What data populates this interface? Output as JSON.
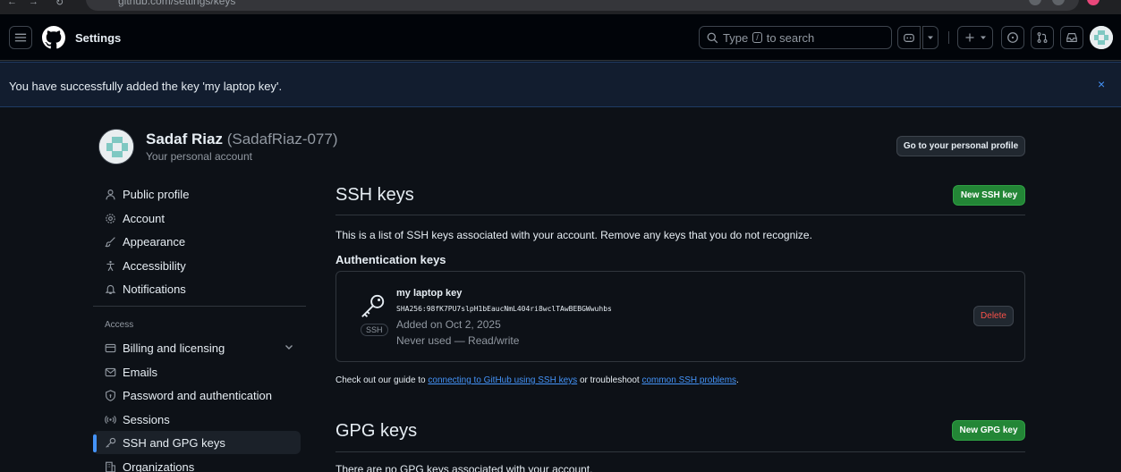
{
  "browser": {
    "url": "github.com/settings/keys"
  },
  "header": {
    "title": "Settings",
    "search_prefix": "Type",
    "search_key": "/",
    "search_suffix": "to search"
  },
  "flash": {
    "message": "You have successfully added the key 'my laptop key'.",
    "close": "×"
  },
  "user": {
    "name": "Sadaf Riaz",
    "login": "(SadafRiaz-077)",
    "subtitle": "Your personal account",
    "profile_button": "Go to your personal profile"
  },
  "sidebar": {
    "items": [
      {
        "label": "Public profile",
        "icon": "person-icon"
      },
      {
        "label": "Account",
        "icon": "gear-icon"
      },
      {
        "label": "Appearance",
        "icon": "paintbrush-icon"
      },
      {
        "label": "Accessibility",
        "icon": "accessibility-icon"
      },
      {
        "label": "Notifications",
        "icon": "bell-icon"
      }
    ],
    "access_heading": "Access",
    "access_items": [
      {
        "label": "Billing and licensing",
        "icon": "credit-card-icon"
      },
      {
        "label": "Emails",
        "icon": "mail-icon"
      },
      {
        "label": "Password and authentication",
        "icon": "shield-lock-icon"
      },
      {
        "label": "Sessions",
        "icon": "broadcast-icon"
      },
      {
        "label": "SSH and GPG keys",
        "icon": "key-icon",
        "active": true
      },
      {
        "label": "Organizations",
        "icon": "organization-icon"
      }
    ]
  },
  "ssh": {
    "title": "SSH keys",
    "new_button": "New SSH key",
    "description": "This is a list of SSH keys associated with your account. Remove any keys that you do not recognize.",
    "auth_heading": "Authentication keys",
    "key": {
      "badge": "SSH",
      "title": "my laptop key",
      "fingerprint": "SHA256:98fK7PU7slpH1bEaucNmL404ri8wclTAwBEBGWwuhbs",
      "added": "Added on Oct 2, 2025",
      "usage": "Never used — Read/write",
      "delete": "Delete"
    },
    "guide_prefix": "Check out our guide to",
    "guide_link1": "connecting to GitHub using SSH keys",
    "guide_middle": "or troubleshoot",
    "guide_link2": "common SSH problems",
    "guide_suffix": "."
  },
  "gpg": {
    "title": "GPG keys",
    "new_button": "New GPG key",
    "description": "There are no GPG keys associated with your account."
  },
  "colors": {
    "background": "#0d1117",
    "header": "#010409",
    "accent": "#4493f8",
    "green": "#238636",
    "danger": "#f85149"
  }
}
